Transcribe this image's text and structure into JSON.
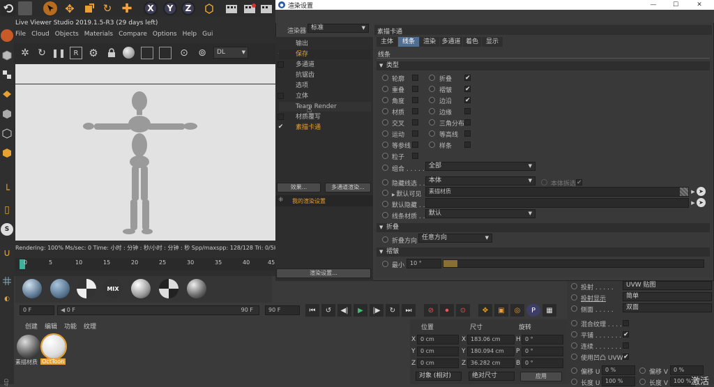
{
  "viewer": {
    "title": "Live Viewer Studio 2019.1.5-R3 (29 days left)",
    "menu": [
      "File",
      "Cloud",
      "Objects",
      "Materials",
      "Compare",
      "Options",
      "Help",
      "Gui"
    ],
    "dropdown": "DL",
    "status": "Rendering: 100%    Ms/sec: 0    Time: 小时 : 分钟 : 秒/小时 : 分钟 : 秒    Spp/maxspp: 128/128    Tri: 0/5k"
  },
  "timeline": {
    "ticks": [
      "0",
      "5",
      "10",
      "15",
      "20",
      "25",
      "30",
      "35",
      "40",
      "45"
    ]
  },
  "frames": {
    "start": "0 F",
    "range": "0 F",
    "end": "90 F",
    "end_field": "90 F"
  },
  "bottom_tabs": [
    "创建",
    "编辑",
    "功能",
    "纹理"
  ],
  "materials": [
    "素描材质",
    "OctToon"
  ],
  "coord": {
    "headers": [
      "位置",
      "尺寸",
      "旋转"
    ],
    "rows": [
      {
        "a": "X",
        "pos": "0 cm",
        "b": "X",
        "size": "183.06 cm",
        "c": "H",
        "rot": "0 °"
      },
      {
        "a": "Y",
        "pos": "0 cm",
        "b": "Y",
        "size": "180.094 cm",
        "c": "P",
        "rot": "0 °"
      },
      {
        "a": "Z",
        "pos": "0 cm",
        "b": "Z",
        "size": "36.282 cm",
        "c": "B",
        "rot": "0 °"
      }
    ],
    "mode": "对象 (相对)",
    "size_mode": "绝对尺寸",
    "apply": "应用"
  },
  "attr": {
    "rows": [
      {
        "label": "投射 . . . . .",
        "value": "UVW 贴图"
      },
      {
        "label": "投射显示",
        "value": "简单"
      },
      {
        "label": "侧面 . . . . .",
        "value": "双面"
      }
    ],
    "checks": [
      {
        "label": "混合纹理 . . . .",
        "checked": false
      },
      {
        "label": "平铺 . . . . . . .",
        "checked": true
      },
      {
        "label": "连续 . . . . . . .",
        "checked": false
      },
      {
        "label": "使用凹凸 UVW",
        "checked": true
      }
    ],
    "offset_u_label": "偏移 U",
    "offset_u": "0 %",
    "offset_v_label": "偏移 V",
    "offset_v": "0 %",
    "len_u_label": "长度 U",
    "len_u": "100 %",
    "len_v_label": "长度 V",
    "len_v": "100 %",
    "watermark": "激活"
  },
  "dialog": {
    "title": "渲染设置",
    "renderer_label": "渲染器",
    "renderer_value": "标准",
    "list": [
      "输出",
      "保存",
      "多通道",
      "抗锯齿",
      "选项",
      "立体",
      "Team Render",
      "材质覆写",
      "素描卡通"
    ],
    "btn_effects": "效果...",
    "btn_multipass": "多通道渲染...",
    "preset": "我的渲染设置",
    "btn_render_settings": "渲染设置...",
    "panel_title": "素描卡通",
    "tabs": [
      "主体",
      "线条",
      "渲染",
      "多通道",
      "着色",
      "显示"
    ],
    "lines_title": "线条",
    "sec_type": "类型",
    "type_left": [
      "轮廓",
      "重叠",
      "角度",
      "材质",
      "交叉",
      "运动",
      "等参线",
      "粒子",
      "组合 . . . . . . ."
    ],
    "type_right": [
      "折叠",
      "褶皱",
      "边沿",
      "边缘",
      "三角分布",
      "等高线",
      "样条"
    ],
    "combo_value": "全部",
    "hidden_label": "隐藏线选 . .",
    "hidden_value": "本体",
    "hidden_check": "本体拆选",
    "default_visible_label": "默认可见",
    "default_visible_value": "素描材质",
    "default_hidden_label": "默认隐藏 . .",
    "line_material_label": "线条材质 . .",
    "line_material_value": "默认",
    "sec_fold": "折叠",
    "fold_dir_label": "折叠方向",
    "fold_dir_value": "任意方向",
    "sec_crease": "褶皱",
    "min_label": "最小",
    "min_value": "10 °"
  }
}
